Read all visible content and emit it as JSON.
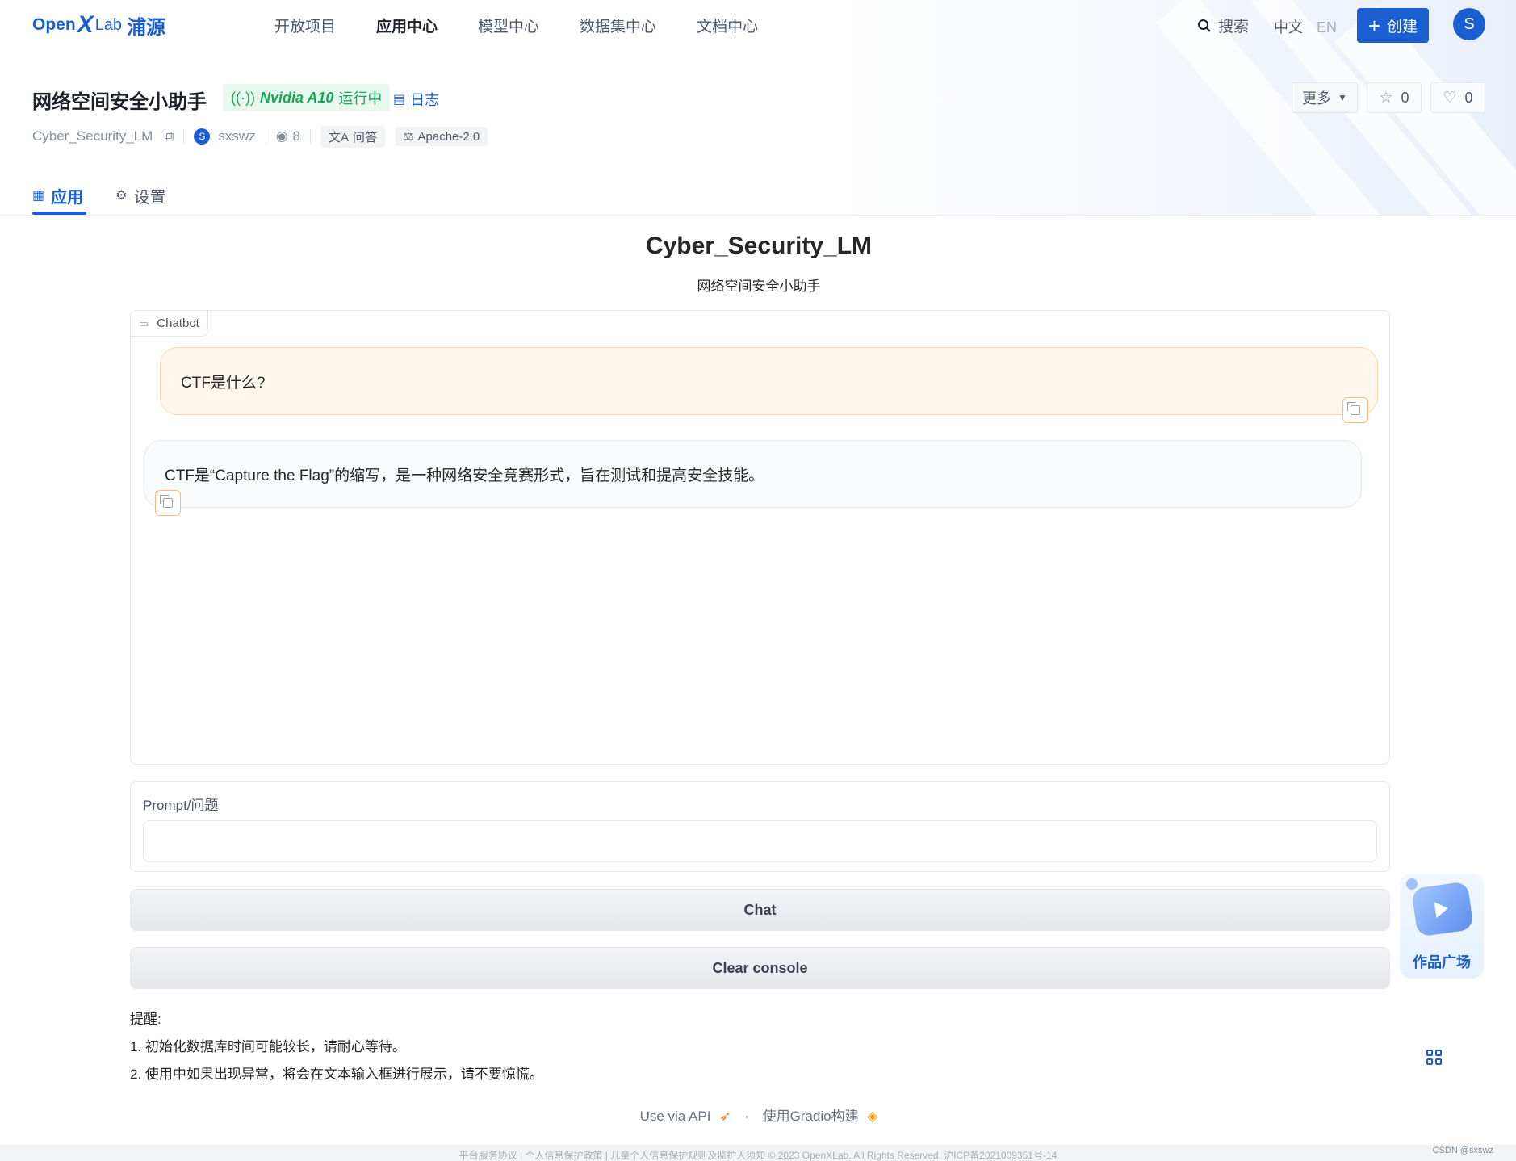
{
  "nav": {
    "logo_open": "Open",
    "logo_x": "X",
    "logo_lab": "Lab",
    "logo_cn": "浦源",
    "items": [
      {
        "label": "开放项目"
      },
      {
        "label": "应用中心"
      },
      {
        "label": "模型中心"
      },
      {
        "label": "数据集中心"
      },
      {
        "label": "文档中心"
      }
    ],
    "search_label": "搜索",
    "lang_zh": "中文",
    "lang_en": "EN",
    "create_label": "创建",
    "avatar_letter": "S",
    "accent": "#1a5fd1"
  },
  "app": {
    "title": "网络空间安全小助手",
    "gpu": "Nvidia A10",
    "status": "运行中",
    "log_label": "日志",
    "repo_name": "Cyber_Security_LM",
    "owner_avatar": "S",
    "owner": "sxswz",
    "views": "8",
    "tags": [
      "问答",
      "Apache-2.0"
    ],
    "more_label": "更多",
    "stars": "0",
    "likes": "0",
    "status_color": "#18a957"
  },
  "tabs": [
    {
      "label": "应用"
    },
    {
      "label": "设置"
    }
  ],
  "gradio": {
    "title": "Cyber_Security_LM",
    "subtitle": "网络空间安全小助手",
    "chatbot_label": "Chatbot",
    "messages": [
      {
        "role": "user",
        "text": "CTF是什么?"
      },
      {
        "role": "bot",
        "text": "CTF是“Capture the Flag”的缩写，是一种网络安全竞赛形式，旨在测试和提高安全技能。"
      }
    ],
    "prompt_label": "Prompt/问题",
    "prompt_value": "",
    "chat_button": "Chat",
    "clear_button": "Clear console",
    "notes": [
      "提醒:",
      "1. 初始化数据库时间可能较长，请耐心等待。",
      "2. 使用中如果出现异常，将会在文本输入框进行展示，请不要惊慌。"
    ],
    "footer_api": "Use via API",
    "footer_built": "使用Gradio构建"
  },
  "float_widget_label": "作品广场",
  "site_footer": "平台服务协议 | 个人信息保护政策 | 儿童个人信息保护规则及监护人须知    © 2023 OpenXLab. All Rights Reserved. 沪ICP备2021009351号-14",
  "watermark": "CSDN @sxswz"
}
